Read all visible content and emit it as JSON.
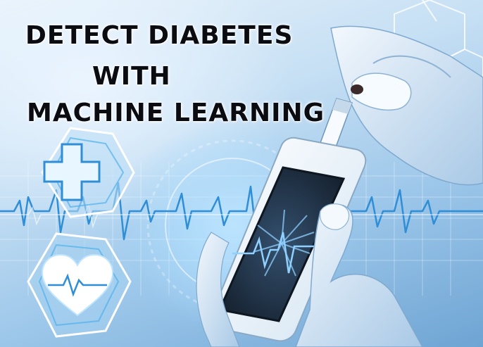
{
  "headline": {
    "line1": "DETECT DIABETES",
    "line2": "WITH",
    "line3": "MACHINE LEARNING"
  },
  "illustration": {
    "icons": [
      "medical-cross-icon",
      "heart-pulse-icon",
      "hexagon-frame-icon"
    ],
    "subject": "glucose-meter-with-test-strip",
    "colors": {
      "background_light": "#e9f3fb",
      "background_deep": "#6ea4d3",
      "glow": "#8fd0ff",
      "device_body": "#f4f8fb",
      "device_screen": "#1d2a3a",
      "ecg_line": "#2f8ed6",
      "headline_text": "#0b0b12"
    }
  }
}
